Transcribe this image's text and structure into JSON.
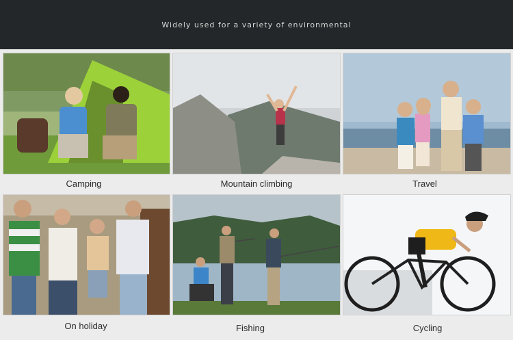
{
  "header": {
    "title": "Widely used for a variety of environmental"
  },
  "tiles": [
    {
      "caption": "Camping"
    },
    {
      "caption": "Mountain climbing"
    },
    {
      "caption": "Travel"
    },
    {
      "caption": "On holiday"
    },
    {
      "caption": "Fishing"
    },
    {
      "caption": "Cycling"
    }
  ]
}
